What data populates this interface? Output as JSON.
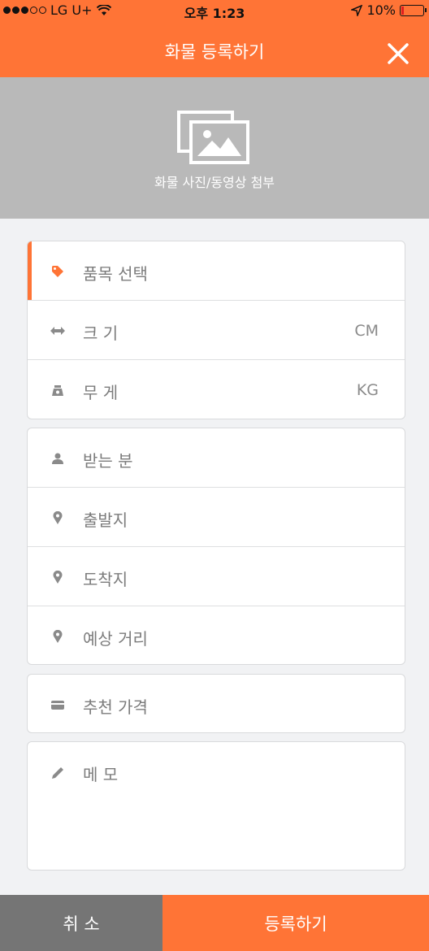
{
  "status_bar": {
    "carrier": "LG U+",
    "time": "오후 1:23",
    "battery": "10%"
  },
  "header": {
    "title": "화물 등록하기"
  },
  "photo": {
    "caption": "화물 사진/동영상 첨부"
  },
  "cargo": {
    "item": "품목 선택",
    "size": "크 기",
    "size_unit": "CM",
    "weight": "무 게",
    "weight_unit": "KG"
  },
  "route": {
    "recipient": "받는 분",
    "origin": "출발지",
    "destination": "도착지",
    "distance": "예상 거리"
  },
  "price": {
    "label": "추천 가격"
  },
  "memo": {
    "label": "메 모"
  },
  "bottom": {
    "cancel": "취 소",
    "submit": "등록하기"
  },
  "colors": {
    "accent": "#ff7436",
    "cancel_bg": "#757575",
    "photo_bg": "#b9b9b9"
  }
}
